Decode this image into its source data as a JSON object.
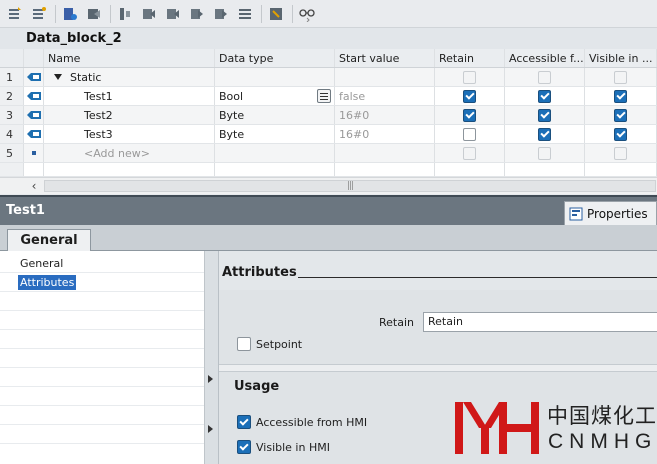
{
  "toolbar": {
    "buttons": [
      "insert-row-icon",
      "add-row-icon",
      "snapshot-icon",
      "copy-snapshot-icon",
      "monitor-icon",
      "load-start-values-icon",
      "load-snapshot-icon",
      "copy-to-start-icon",
      "compare-icon",
      "list-view-icon",
      "keep-actual-icon",
      "glasses-icon"
    ]
  },
  "block": {
    "title": "Data_block_2"
  },
  "table": {
    "columns": {
      "name": "Name",
      "type": "Data type",
      "start": "Start value",
      "retain": "Retain",
      "access": "Accessible f...",
      "visible": "Visible in ..."
    },
    "rows": [
      {
        "num": "1",
        "name": "Static",
        "type": "",
        "start": "",
        "retain": false,
        "access": false,
        "visible": false,
        "disabled": true
      },
      {
        "num": "2",
        "name": "Test1",
        "type": "Bool",
        "start": "false",
        "retain": true,
        "access": true,
        "visible": true,
        "disabled": false
      },
      {
        "num": "3",
        "name": "Test2",
        "type": "Byte",
        "start": "16#0",
        "retain": true,
        "access": true,
        "visible": true,
        "disabled": false
      },
      {
        "num": "4",
        "name": "Test3",
        "type": "Byte",
        "start": "16#0",
        "retain": false,
        "access": true,
        "visible": true,
        "disabled": false
      },
      {
        "num": "5",
        "name": "<Add new>",
        "type": "",
        "start": "",
        "retain": false,
        "access": false,
        "visible": false,
        "disabled": true
      }
    ],
    "scroll_grip": "|||"
  },
  "inspector": {
    "title": "Test1",
    "properties_tab": "Properties",
    "general_tab": "General",
    "nav": [
      "General",
      "Attributes"
    ],
    "attributes": {
      "heading": "Attributes",
      "retain_label": "Retain",
      "retain_value": "Retain",
      "setpoint_label": "Setpoint",
      "setpoint_checked": false
    },
    "usage": {
      "heading": "Usage",
      "accessible_label": "Accessible from HMI",
      "accessible_checked": true,
      "visible_label": "Visible in HMI",
      "visible_checked": true
    }
  },
  "logo": {
    "cn": "中国煤化工",
    "en": "CNMHG"
  },
  "colors": {
    "accent": "#2a6cc0",
    "check_blue": "#1b6fb8",
    "inspector_header": "#6b7680",
    "logo_red": "#d01818"
  }
}
